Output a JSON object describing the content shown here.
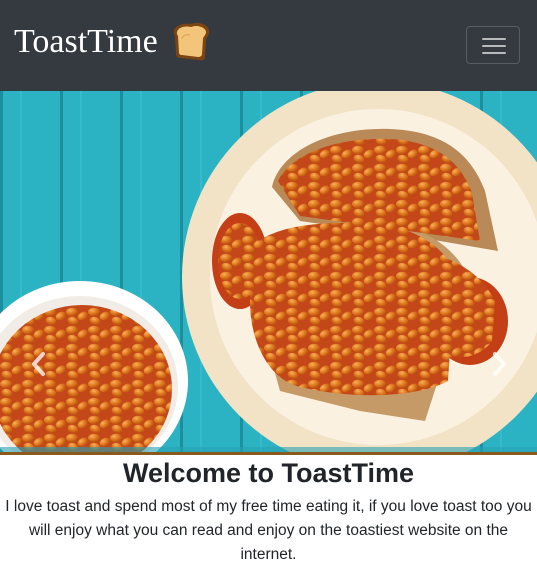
{
  "navbar": {
    "brand": "ToastTime",
    "logo_icon": "toast-icon",
    "toggle_icon": "menu-icon",
    "background": "#343a40"
  },
  "carousel": {
    "prev_icon": "chevron-left-icon",
    "next_icon": "chevron-right-icon",
    "slide_image": "beans-on-toast-photo"
  },
  "main": {
    "heading": "Welcome to ToastTime",
    "intro": "I love toast and spend most of my free time eating it, if you love toast too you will enjoy what you can read and enjoy on the toastiest website on the internet."
  },
  "colors": {
    "accent_rule": "#8a5a1c",
    "table_teal": "#2fb6c6",
    "text": "#212529"
  }
}
